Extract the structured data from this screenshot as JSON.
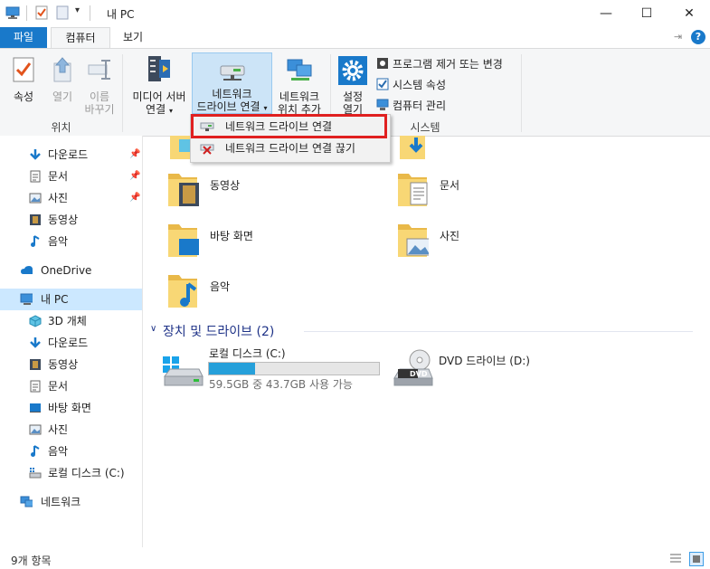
{
  "window": {
    "title": "내 PC",
    "controls": {
      "minimize": "—",
      "maximize": "☐",
      "close": "✕"
    }
  },
  "tabs": {
    "file": "파일",
    "computer": "컴퓨터",
    "view": "보기"
  },
  "ribbon": {
    "properties": "속성",
    "open": "열기",
    "rename_line1": "이름",
    "rename_line2": "바꾸기",
    "media_server_line1": "미디어 서버",
    "media_server_line2": "연결",
    "map_drive_line1": "네트워크",
    "map_drive_line2": "드라이브 연결",
    "add_location_line1": "네트워크",
    "add_location_line2": "위치 추가",
    "settings_line1": "설정",
    "settings_line2": "열기",
    "uninstall": "프로그램 제거 또는 변경",
    "system_props": "시스템 속성",
    "manage": "컴퓨터 관리",
    "group_location": "위치",
    "group_system": "시스템"
  },
  "menu": {
    "connect": "네트워크 드라이브 연결",
    "disconnect": "네트워크 드라이브 연결 끊기"
  },
  "nav": {
    "quick": [
      {
        "label": "다운로드",
        "icon": "download-icon",
        "pinned": "📌"
      },
      {
        "label": "문서",
        "icon": "document-icon",
        "pinned": "📌"
      },
      {
        "label": "사진",
        "icon": "picture-icon",
        "pinned": "📌"
      },
      {
        "label": "동영상",
        "icon": "video-icon",
        "pinned": ""
      },
      {
        "label": "음악",
        "icon": "music-icon",
        "pinned": ""
      }
    ],
    "onedrive": "OneDrive",
    "thispc": "내 PC",
    "pc_items": [
      "3D 개체",
      "다운로드",
      "동영상",
      "문서",
      "바탕 화면",
      "사진",
      "음악",
      "로컬 디스크 (C:)"
    ],
    "network": "네트워크"
  },
  "content": {
    "folders_left": [
      "동영상",
      "바탕 화면",
      "음악"
    ],
    "folders_right": [
      "문서",
      "사진"
    ],
    "devices_header": "장치 및 드라이브 (2)",
    "drive_c_name": "로컬 디스크 (C:)",
    "drive_c_usage": "59.5GB 중 43.7GB 사용 가능",
    "drive_c_used_fraction": 0.27,
    "dvd_name": "DVD 드라이브 (D:)",
    "dvd_label": "DVD"
  },
  "status": {
    "count": "9개 항목"
  },
  "colors": {
    "accent": "#1979ca",
    "highlight": "#e02020",
    "selection": "#cce8ff"
  }
}
